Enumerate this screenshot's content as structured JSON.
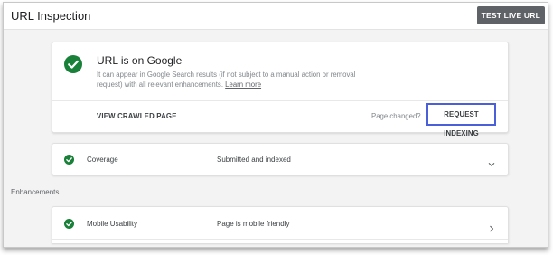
{
  "header": {
    "title": "URL Inspection",
    "test_live_label": "TEST LIVE URL"
  },
  "status": {
    "title": "URL is on Google",
    "description": "It can appear in Google Search results (if not subject to a manual action or removal request) with all relevant enhancements.",
    "learn_more": "Learn more",
    "view_crawled_label": "VIEW CRAWLED PAGE",
    "page_changed_label": "Page changed?",
    "request_indexing_label": "REQUEST INDEXING",
    "icon": "check-circle-icon",
    "accent_color": "#188038",
    "highlight_color": "#4a5fd8"
  },
  "coverage": {
    "label": "Coverage",
    "value": "Submitted and indexed",
    "icon": "check-circle-icon",
    "action_icon": "chevron-down-icon"
  },
  "enhancements": {
    "heading": "Enhancements",
    "items": [
      {
        "label": "Mobile Usability",
        "value": "Page is mobile friendly",
        "icon": "check-circle-icon",
        "action_icon": "chevron-right-icon"
      }
    ]
  }
}
